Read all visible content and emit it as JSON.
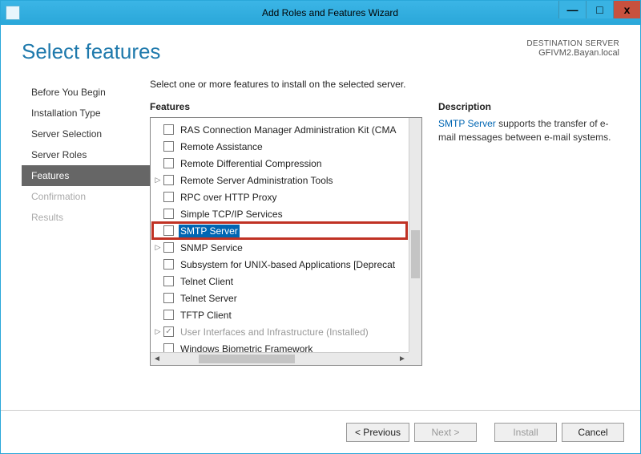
{
  "window": {
    "title": "Add Roles and Features Wizard",
    "controls": {
      "min": "—",
      "max": "□",
      "close": "x"
    }
  },
  "header": {
    "page_title": "Select features",
    "dest_label": "DESTINATION SERVER",
    "dest_name": "GFIVM2.Bayan.local"
  },
  "sidebar": {
    "steps": [
      {
        "label": "Before You Begin",
        "state": "normal"
      },
      {
        "label": "Installation Type",
        "state": "normal"
      },
      {
        "label": "Server Selection",
        "state": "normal"
      },
      {
        "label": "Server Roles",
        "state": "normal"
      },
      {
        "label": "Features",
        "state": "active"
      },
      {
        "label": "Confirmation",
        "state": "disabled"
      },
      {
        "label": "Results",
        "state": "disabled"
      }
    ]
  },
  "main": {
    "instruction": "Select one or more features to install on the selected server.",
    "features_heading": "Features",
    "description_heading": "Description",
    "description_link": "SMTP Server",
    "description_rest": " supports the transfer of e-mail messages between e-mail systems."
  },
  "features": [
    {
      "label": "RAS Connection Manager Administration Kit (CMA",
      "expand": "",
      "checked": false
    },
    {
      "label": "Remote Assistance",
      "expand": "",
      "checked": false
    },
    {
      "label": "Remote Differential Compression",
      "expand": "",
      "checked": false
    },
    {
      "label": "Remote Server Administration Tools",
      "expand": "▷",
      "checked": false
    },
    {
      "label": "RPC over HTTP Proxy",
      "expand": "",
      "checked": false
    },
    {
      "label": "Simple TCP/IP Services",
      "expand": "",
      "checked": false
    },
    {
      "label": "SMTP Server",
      "expand": "",
      "checked": false,
      "selected": true,
      "highlighted": true
    },
    {
      "label": "SNMP Service",
      "expand": "▷",
      "checked": false
    },
    {
      "label": "Subsystem for UNIX-based Applications [Deprecat",
      "expand": "",
      "checked": false
    },
    {
      "label": "Telnet Client",
      "expand": "",
      "checked": false
    },
    {
      "label": "Telnet Server",
      "expand": "",
      "checked": false
    },
    {
      "label": "TFTP Client",
      "expand": "",
      "checked": false
    },
    {
      "label": "User Interfaces and Infrastructure (Installed)",
      "expand": "▷",
      "checked": true,
      "installed": true
    },
    {
      "label": "Windows Biometric Framework",
      "expand": "",
      "checked": false
    }
  ],
  "footer": {
    "previous": "<  Previous",
    "next": "Next  >",
    "install": "Install",
    "cancel": "Cancel"
  }
}
